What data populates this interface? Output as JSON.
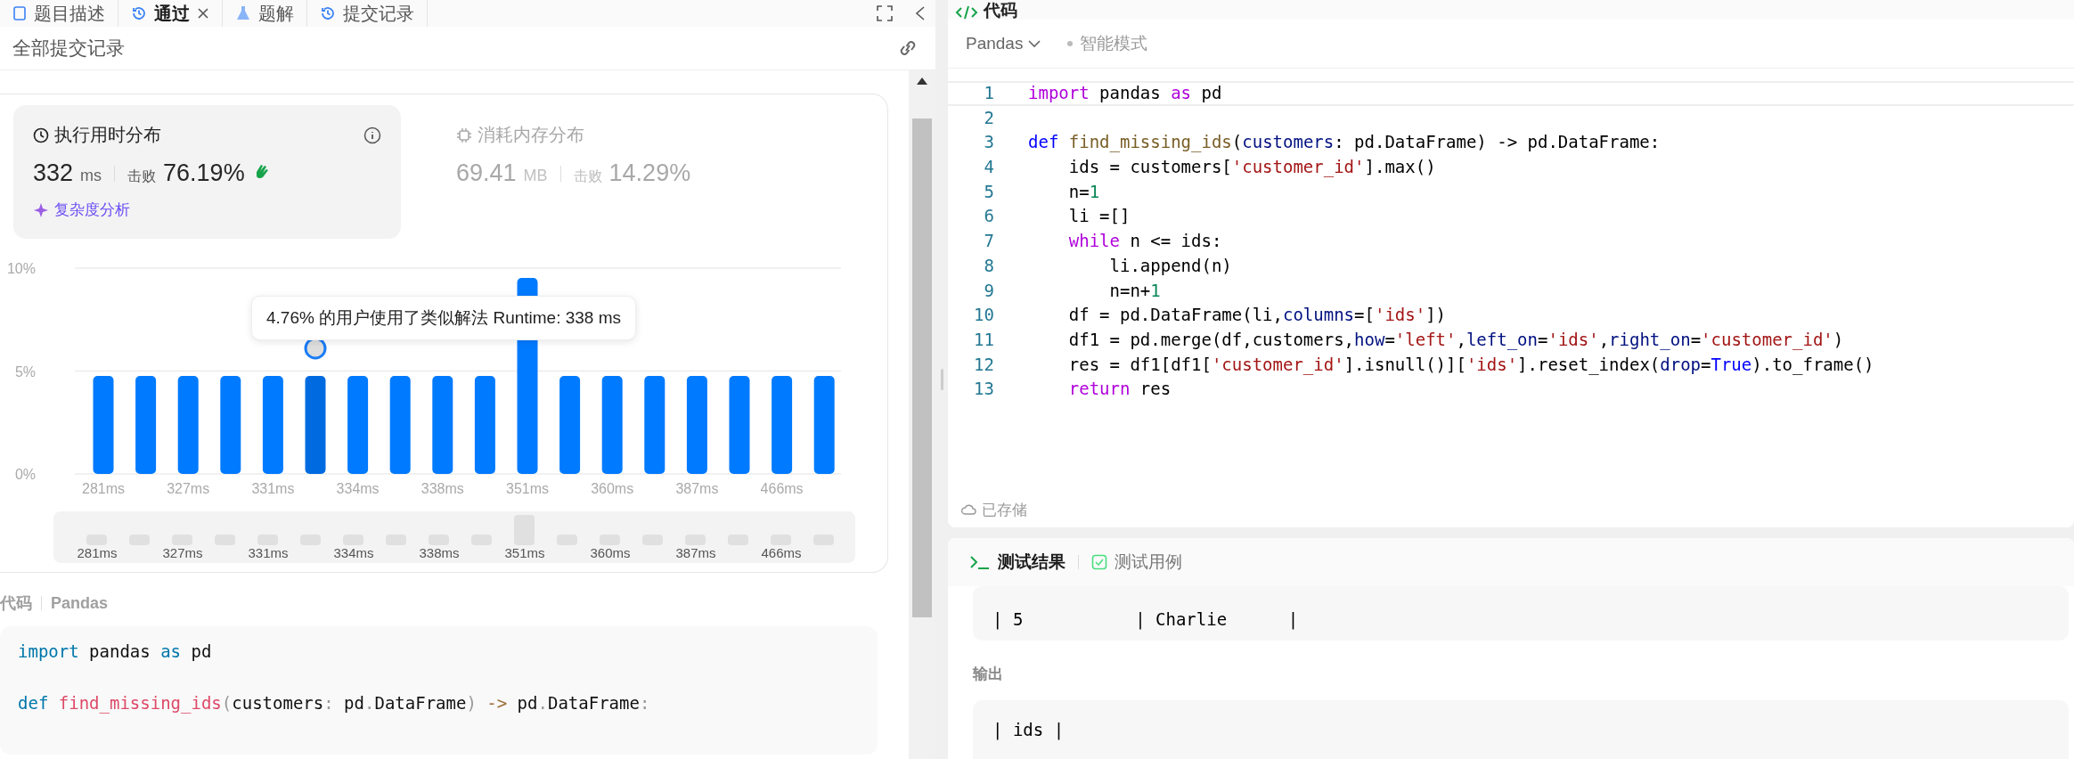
{
  "left_tabs": [
    {
      "label": "题目描述",
      "selected": false,
      "closable": false
    },
    {
      "label": "通过",
      "selected": true,
      "closable": true
    },
    {
      "label": "题解",
      "selected": false,
      "closable": false
    },
    {
      "label": "提交记录",
      "selected": false,
      "closable": false
    }
  ],
  "submissions_header": {
    "title": "全部提交记录"
  },
  "runtime_card": {
    "title": "执行用时分布",
    "value": "332",
    "unit": "ms",
    "beat_label": "击败",
    "beat": "76.19%",
    "link": "复杂度分析",
    "selected": true
  },
  "memory_card": {
    "title": "消耗内存分布",
    "value": "69.41",
    "unit": "MB",
    "beat_label": "击败",
    "beat": "14.29%",
    "selected": false
  },
  "chart_data": {
    "type": "bar",
    "categories": [
      "281ms",
      null,
      "327ms",
      null,
      "331ms",
      null,
      "334ms",
      null,
      "338ms",
      null,
      "351ms",
      null,
      "360ms",
      null,
      "387ms",
      null,
      "466ms",
      null
    ],
    "series": [
      {
        "color": "#007aff",
        "values": [
          4.76,
          4.76,
          4.76,
          4.76,
          4.76,
          4.76,
          4.76,
          4.76,
          4.76,
          4.76,
          9.52,
          4.76,
          4.76,
          4.76,
          4.76,
          4.76,
          4.76,
          4.76
        ]
      }
    ],
    "ylim": [
      0,
      10
    ],
    "yticks": [
      {
        "value": 0,
        "label": "0%"
      },
      {
        "value": 5,
        "label": "5%"
      },
      {
        "value": 10,
        "label": "10%"
      }
    ],
    "annotations": [
      "4.76% 的用户使用了类似解法 Runtime: 338 ms"
    ]
  },
  "chart_bars": [
    {
      "selected": false
    },
    {
      "selected": false
    },
    {
      "selected": false
    },
    {
      "selected": false
    },
    {
      "selected": false
    },
    {
      "selected": true
    },
    {
      "selected": false
    },
    {
      "selected": false
    },
    {
      "selected": false
    },
    {
      "selected": false
    },
    {
      "selected": false
    },
    {
      "selected": false
    },
    {
      "selected": false
    },
    {
      "selected": false
    },
    {
      "selected": false
    },
    {
      "selected": false
    },
    {
      "selected": false
    },
    {
      "selected": false
    }
  ],
  "overview": {
    "labels": [
      "281ms",
      "327ms",
      "331ms",
      "334ms",
      "338ms",
      "351ms",
      "360ms",
      "387ms",
      "466ms"
    ]
  },
  "submitted_code": {
    "title": "代码",
    "language": "Pandas",
    "lines": [
      {
        "tokens": [
          {
            "text": "import",
            "kind": "kw"
          },
          {
            "text": " pandas ",
            "kind": "p"
          },
          {
            "text": "as",
            "kind": "kw"
          },
          {
            "text": " pd",
            "kind": "p"
          }
        ]
      },
      {
        "gap_before": true,
        "tokens": [
          {
            "text": "def ",
            "kind": "kw"
          },
          {
            "text": "find_missing_ids",
            "kind": "fn"
          },
          {
            "text": "(",
            "kind": "punct"
          },
          {
            "text": "customers",
            "kind": "p"
          },
          {
            "text": ":",
            "kind": "punct"
          },
          {
            "text": " pd",
            "kind": "p"
          },
          {
            "text": ".",
            "kind": "punct"
          },
          {
            "text": "DataFrame",
            "kind": "p"
          },
          {
            "text": ")",
            "kind": "punct"
          },
          {
            "text": " ->",
            "kind": "op"
          },
          {
            "text": " pd",
            "kind": "p"
          },
          {
            "text": ".",
            "kind": "punct"
          },
          {
            "text": "DataFrame",
            "kind": "p"
          },
          {
            "text": ":",
            "kind": "punct"
          }
        ]
      }
    ]
  },
  "editor": {
    "title": "代码",
    "language": "Pandas",
    "mode": "智能模式",
    "saved": "已存储",
    "lines": [
      {
        "number": "1",
        "tokens": [
          {
            "text": "import",
            "kind": "ctrl"
          },
          {
            "text": " pandas ",
            "kind": "p"
          },
          {
            "text": "as",
            "kind": "ctrl"
          },
          {
            "text": " pd",
            "kind": "p"
          }
        ]
      },
      {
        "number": "2"
      },
      {
        "number": "3",
        "tokens": [
          {
            "text": "def ",
            "kind": "def"
          },
          {
            "text": "find_missing_ids",
            "kind": "fn"
          },
          {
            "text": "(",
            "kind": "p"
          },
          {
            "text": "customers",
            "kind": "var"
          },
          {
            "text": ": pd.DataFrame) -> pd.DataFrame:",
            "kind": "p"
          }
        ]
      },
      {
        "number": "4",
        "tokens": [
          {
            "text": "    ids = customers[",
            "kind": "p"
          },
          {
            "text": "'customer_id'",
            "kind": "str"
          },
          {
            "text": "].max()",
            "kind": "p"
          }
        ]
      },
      {
        "number": "5",
        "tokens": [
          {
            "text": "    n=",
            "kind": "p"
          },
          {
            "text": "1",
            "kind": "num"
          }
        ]
      },
      {
        "number": "6",
        "tokens": [
          {
            "text": "    li =[]",
            "kind": "p"
          }
        ]
      },
      {
        "number": "7",
        "tokens": [
          {
            "text": "    while",
            "kind": "ctrl"
          },
          {
            "text": " n <= ids:",
            "kind": "p"
          }
        ]
      },
      {
        "number": "8",
        "tokens": [
          {
            "text": "        li.append(n)",
            "kind": "p"
          }
        ]
      },
      {
        "number": "9",
        "tokens": [
          {
            "text": "        n=n+",
            "kind": "p"
          },
          {
            "text": "1",
            "kind": "num"
          }
        ]
      },
      {
        "number": "10",
        "tokens": [
          {
            "text": "    df = pd.DataFrame(li,",
            "kind": "p"
          },
          {
            "text": "columns",
            "kind": "var"
          },
          {
            "text": "=[",
            "kind": "p"
          },
          {
            "text": "'ids'",
            "kind": "str"
          },
          {
            "text": "])",
            "kind": "p"
          }
        ]
      },
      {
        "number": "11",
        "tokens": [
          {
            "text": "    df1 = pd.merge(df,customers,",
            "kind": "p"
          },
          {
            "text": "how",
            "kind": "var"
          },
          {
            "text": "=",
            "kind": "p"
          },
          {
            "text": "'left'",
            "kind": "str"
          },
          {
            "text": ",",
            "kind": "p"
          },
          {
            "text": "left_on",
            "kind": "var"
          },
          {
            "text": "=",
            "kind": "p"
          },
          {
            "text": "'ids'",
            "kind": "str"
          },
          {
            "text": ",",
            "kind": "p"
          },
          {
            "text": "right_on",
            "kind": "var"
          },
          {
            "text": "=",
            "kind": "p"
          },
          {
            "text": "'customer_id'",
            "kind": "str"
          },
          {
            "text": ")",
            "kind": "p"
          }
        ]
      },
      {
        "number": "12",
        "tokens": [
          {
            "text": "    res = df1[df1[",
            "kind": "p"
          },
          {
            "text": "'customer_id'",
            "kind": "str"
          },
          {
            "text": "].isnull()][",
            "kind": "p"
          },
          {
            "text": "'ids'",
            "kind": "str"
          },
          {
            "text": "].reset_index(",
            "kind": "p"
          },
          {
            "text": "drop",
            "kind": "var"
          },
          {
            "text": "=",
            "kind": "p"
          },
          {
            "text": "True",
            "kind": "def"
          },
          {
            "text": ").to_frame()",
            "kind": "p"
          }
        ]
      },
      {
        "number": "13",
        "tokens": [
          {
            "text": "    return",
            "kind": "ctrl"
          },
          {
            "text": " res",
            "kind": "p"
          }
        ]
      }
    ]
  },
  "console": {
    "tabs": [
      {
        "label": "测试结果",
        "selected": true
      },
      {
        "label": "测试用例",
        "selected": false
      }
    ],
    "input_rows": [
      "| 5           | Charlie      |"
    ],
    "output_label": "输出",
    "output_rows": [
      "| ids |"
    ]
  }
}
